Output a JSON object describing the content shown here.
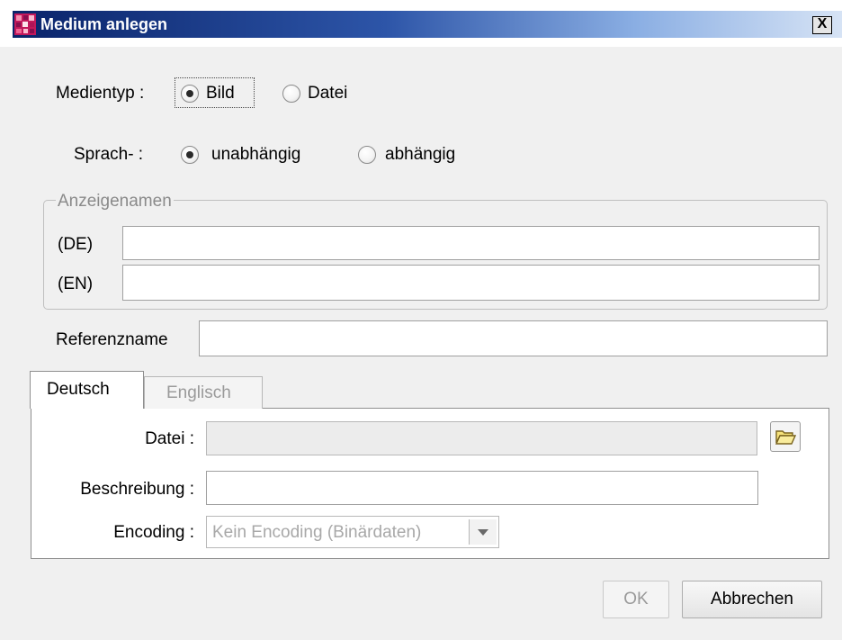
{
  "window": {
    "title": "Medium anlegen",
    "close_label": "X"
  },
  "media_type": {
    "label": "Medientyp :",
    "options": [
      {
        "label": "Bild",
        "selected": true
      },
      {
        "label": "Datei",
        "selected": false
      }
    ]
  },
  "language": {
    "label": "Sprach- :",
    "options": [
      {
        "label": "unabhängig",
        "selected": true
      },
      {
        "label": "abhängig",
        "selected": false
      }
    ]
  },
  "display_names": {
    "legend": "Anzeigenamen",
    "rows": [
      {
        "lang": "(DE)",
        "value": ""
      },
      {
        "lang": "(EN)",
        "value": ""
      }
    ]
  },
  "reference": {
    "label": "Referenzname",
    "value": ""
  },
  "tabs": [
    {
      "label": "Deutsch",
      "active": true
    },
    {
      "label": "Englisch",
      "active": false
    }
  ],
  "file_form": {
    "file_label": "Datei :",
    "file_value": "",
    "description_label": "Beschreibung :",
    "description_value": "",
    "encoding_label": "Encoding :",
    "encoding_value": "Kein Encoding (Binärdaten)",
    "browse_icon": "folder-open-icon"
  },
  "buttons": {
    "ok": "OK",
    "cancel": "Abbrechen"
  }
}
